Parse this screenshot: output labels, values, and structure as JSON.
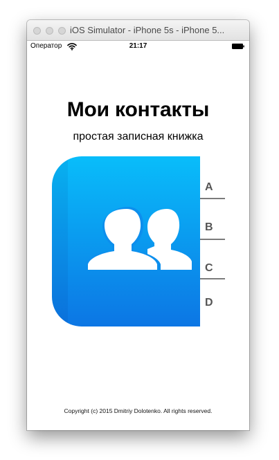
{
  "window": {
    "title": "iOS Simulator - iPhone 5s - iPhone 5..."
  },
  "status_bar": {
    "carrier": "Оператор",
    "time": "21:17",
    "icons": [
      "wifi-icon",
      "battery-icon"
    ]
  },
  "app": {
    "title": "Мои контакты",
    "subtitle": "простая записная книжка",
    "logo_icon": "people-icon",
    "colors": {
      "book_top": "#09bdfa",
      "book_bottom": "#0c76e4",
      "tab_text": "#555555",
      "tab_line": "#7b7b7b"
    },
    "tabs": [
      "A",
      "B",
      "C",
      "D"
    ],
    "copyright": "Copyright (c) 2015 Dmitriy Dolotenko. All rights reserved."
  }
}
